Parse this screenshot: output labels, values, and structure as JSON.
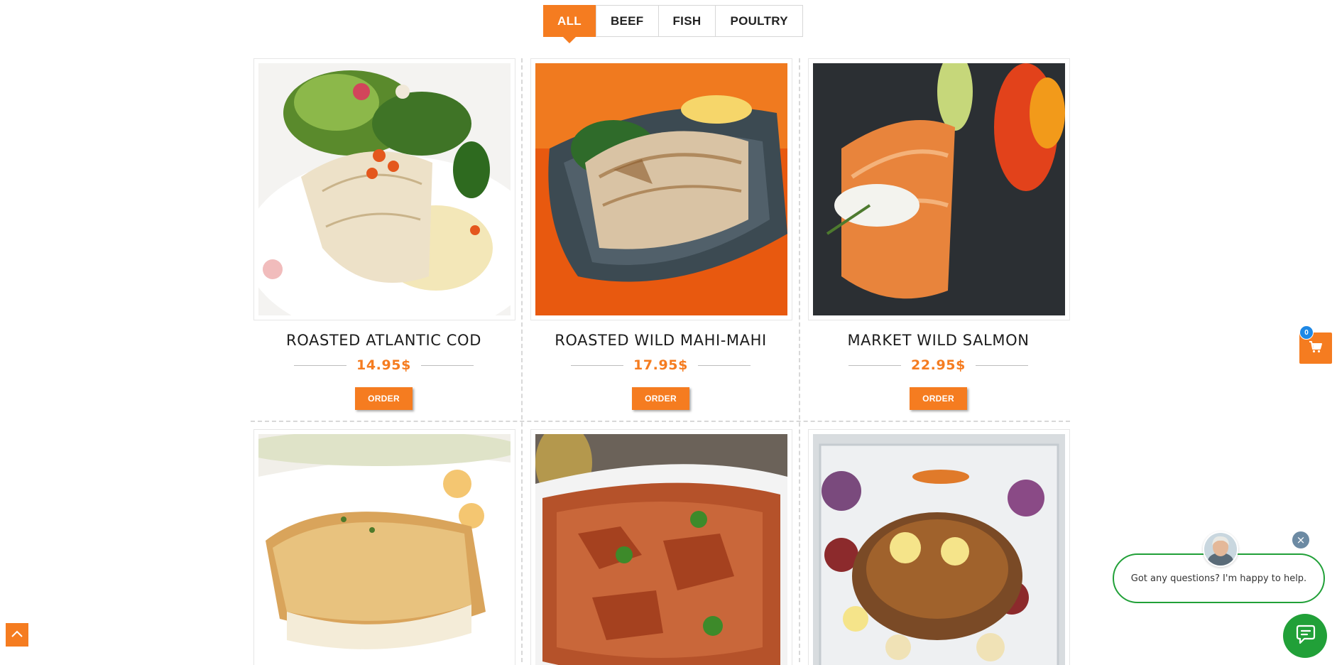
{
  "filters": {
    "tabs": [
      {
        "label": "ALL",
        "active": true
      },
      {
        "label": "BEEF",
        "active": false
      },
      {
        "label": "FISH",
        "active": false
      },
      {
        "label": "POULTRY",
        "active": false
      }
    ]
  },
  "menu": {
    "items": [
      {
        "title": "ROASTED ATLANTIC COD",
        "price": "14.95$",
        "order_label": "ORDER",
        "image": "roasted-cod-with-salad"
      },
      {
        "title": "ROASTED WILD MAHI-MAHI",
        "price": "17.95$",
        "order_label": "ORDER",
        "image": "grilled-mahi-mahi-on-plate"
      },
      {
        "title": "MARKET WILD SALMON",
        "price": "22.95$",
        "order_label": "ORDER",
        "image": "salmon-with-peppers"
      },
      {
        "image": "baked-white-fish-fillet"
      },
      {
        "image": "pulled-meat-in-baking-dish"
      },
      {
        "image": "roasted-chicken-with-vegetables"
      }
    ]
  },
  "cart": {
    "count": "0",
    "icon": "cart-icon"
  },
  "chat": {
    "message": "Got any questions? I'm happy to help.",
    "close_icon": "close-icon",
    "launcher_icon": "chat-icon"
  },
  "back_to_top": {
    "icon": "chevron-up-icon"
  },
  "colors": {
    "accent": "#f57c20",
    "chat_green": "#21a038",
    "badge_blue": "#1e88e5"
  }
}
